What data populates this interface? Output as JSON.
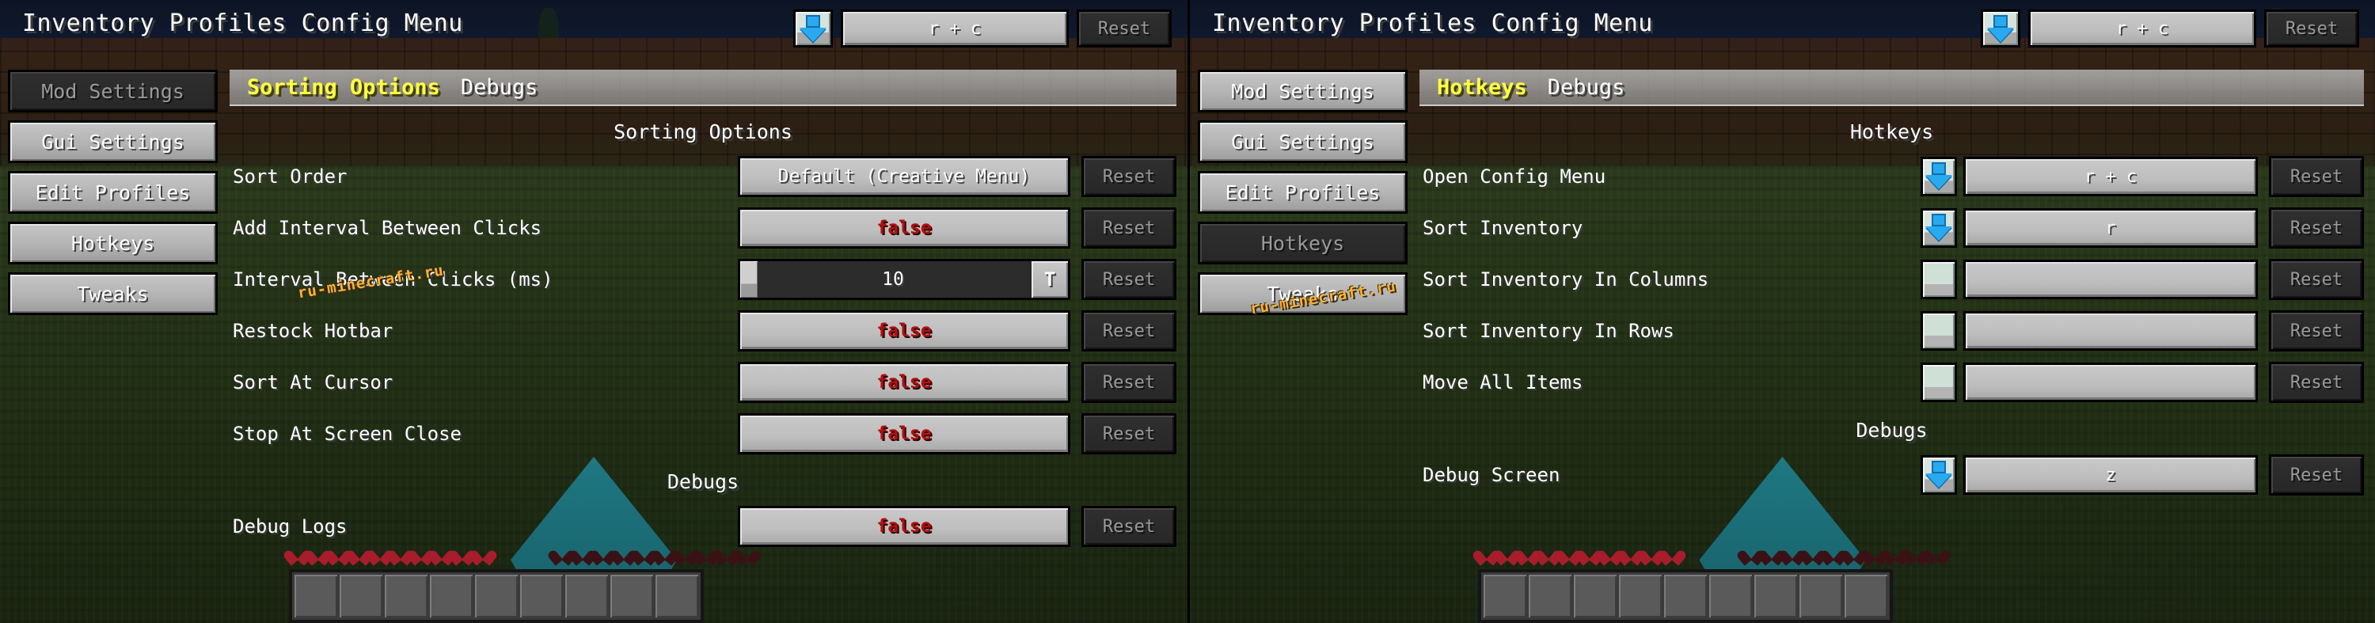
{
  "app": {
    "title": "Inventory Profiles Config Menu",
    "reset_label": "Reset",
    "watermark": "ru-minecraft.ru",
    "icon_names": {
      "keybind": "keybind-arrow-down-icon",
      "text_toggle": "text-input-toggle-icon"
    }
  },
  "panels": [
    {
      "id": "left",
      "title": "Inventory Profiles Config Menu",
      "header_keybind": {
        "value": "r + c",
        "reset_label": "Reset",
        "icon": "arrow-down-icon"
      },
      "sidebar": [
        {
          "label": "Mod Settings",
          "state": "disabled"
        },
        {
          "label": "Gui Settings",
          "state": "enabled"
        },
        {
          "label": "Edit Profiles",
          "state": "enabled"
        },
        {
          "label": "Hotkeys",
          "state": "enabled"
        },
        {
          "label": "Tweaks",
          "state": "enabled"
        }
      ],
      "tabs": [
        {
          "label": "Sorting Options",
          "active": true
        },
        {
          "label": "Debugs",
          "active": false
        }
      ],
      "sections": [
        {
          "heading": "Sorting Options",
          "rows": [
            {
              "label": "Sort Order",
              "type": "choice",
              "value": "Default (Creative Menu)",
              "reset_label": "Reset",
              "reset_enabled": false
            },
            {
              "label": "Add Interval Between Clicks",
              "type": "boolean",
              "value": "false",
              "reset_label": "Reset",
              "reset_enabled": false
            },
            {
              "label": "Interval Between Clicks (ms)",
              "type": "number",
              "value": "10",
              "text_toggle": "T",
              "reset_label": "Reset",
              "reset_enabled": false
            },
            {
              "label": "Restock Hotbar",
              "type": "boolean",
              "value": "false",
              "reset_label": "Reset",
              "reset_enabled": false
            },
            {
              "label": "Sort At Cursor",
              "type": "boolean",
              "value": "false",
              "reset_label": "Reset",
              "reset_enabled": false
            },
            {
              "label": "Stop At Screen Close",
              "type": "boolean",
              "value": "false",
              "reset_label": "Reset",
              "reset_enabled": false
            }
          ]
        },
        {
          "heading": "Debugs",
          "rows": [
            {
              "label": "Debug Logs",
              "type": "boolean",
              "value": "false",
              "reset_label": "Reset",
              "reset_enabled": false
            }
          ]
        }
      ]
    },
    {
      "id": "right",
      "title": "Inventory Profiles Config Menu",
      "header_keybind": {
        "value": "r + c",
        "reset_label": "Reset",
        "icon": "arrow-down-icon"
      },
      "sidebar": [
        {
          "label": "Mod Settings",
          "state": "enabled"
        },
        {
          "label": "Gui Settings",
          "state": "enabled"
        },
        {
          "label": "Edit Profiles",
          "state": "enabled"
        },
        {
          "label": "Hotkeys",
          "state": "disabled"
        },
        {
          "label": "Tweaks",
          "state": "enabled"
        }
      ],
      "tabs": [
        {
          "label": "Hotkeys",
          "active": true
        },
        {
          "label": "Debugs",
          "active": false
        }
      ],
      "sections": [
        {
          "heading": "Hotkeys",
          "rows": [
            {
              "label": "Open Config Menu",
              "type": "hotkey",
              "value": "r + c",
              "bound": true,
              "reset_label": "Reset",
              "reset_enabled": false
            },
            {
              "label": "Sort Inventory",
              "type": "hotkey",
              "value": "r",
              "bound": true,
              "reset_label": "Reset",
              "reset_enabled": false
            },
            {
              "label": "Sort Inventory In Columns",
              "type": "hotkey",
              "value": "",
              "bound": false,
              "reset_label": "Reset",
              "reset_enabled": false
            },
            {
              "label": "Sort Inventory In Rows",
              "type": "hotkey",
              "value": "",
              "bound": false,
              "reset_label": "Reset",
              "reset_enabled": false
            },
            {
              "label": "Move All Items",
              "type": "hotkey",
              "value": "",
              "bound": false,
              "reset_label": "Reset",
              "reset_enabled": false
            }
          ]
        },
        {
          "heading": "Debugs",
          "rows": [
            {
              "label": "Debug Screen",
              "type": "hotkey",
              "value": "z",
              "bound": true,
              "reset_label": "Reset",
              "reset_enabled": false
            }
          ]
        }
      ]
    }
  ],
  "hud": {
    "hearts_full": 10,
    "hearts_empty": 10,
    "hotbar_slots": 9
  }
}
